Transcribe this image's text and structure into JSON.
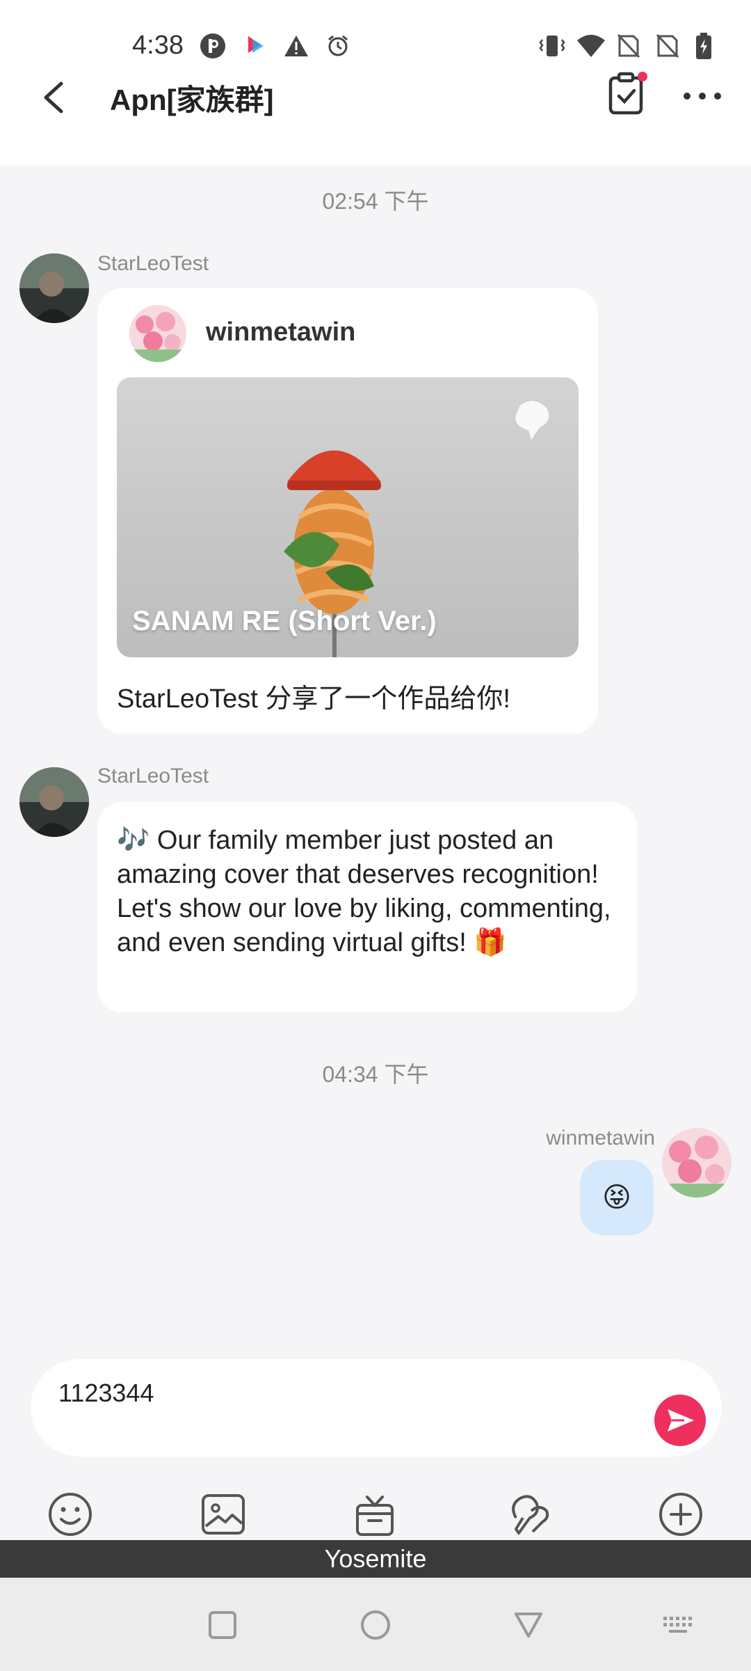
{
  "status_bar": {
    "time": "4:38",
    "left_icons": [
      "p-icon",
      "app-notification-icon",
      "warning-icon",
      "alarm-icon"
    ],
    "right_icons": [
      "vibrate-icon",
      "wifi-icon",
      "no-sim-icon",
      "no-sim-icon",
      "battery-charging-icon"
    ]
  },
  "header": {
    "title": "Apn[家族群]",
    "back_icon": "chevron-left-icon",
    "task_icon": "clipboard-check-icon",
    "more_icon": "more-dots-icon"
  },
  "chat": {
    "timestamp_1": "02:54 下午",
    "timestamp_2": "04:34 下午",
    "msg1": {
      "sender": "StarLeoTest",
      "card_user": "winmetawin",
      "card_title": "SANAM RE (Short Ver.)",
      "caption": "StarLeoTest 分享了一个作品给你!"
    },
    "msg2": {
      "sender": "StarLeoTest",
      "text": "🎶 Our family member just posted an amazing cover that deserves recognition! Let's show our love by liking, commenting, and even sending virtual gifts! 🎁"
    },
    "msg3": {
      "sender": "winmetawin",
      "emoji": "😝"
    }
  },
  "composer": {
    "value": "1123344",
    "send_icon": "send-icon"
  },
  "toolbar": [
    "emoji-icon",
    "image-icon",
    "gift-icon",
    "duet-mic-icon",
    "plus-icon"
  ],
  "keyboard_label": "Yosemite",
  "colors": {
    "accent": "#ef2f5d",
    "own_bubble": "#d6e8fb",
    "background": "#f5f5f7"
  }
}
